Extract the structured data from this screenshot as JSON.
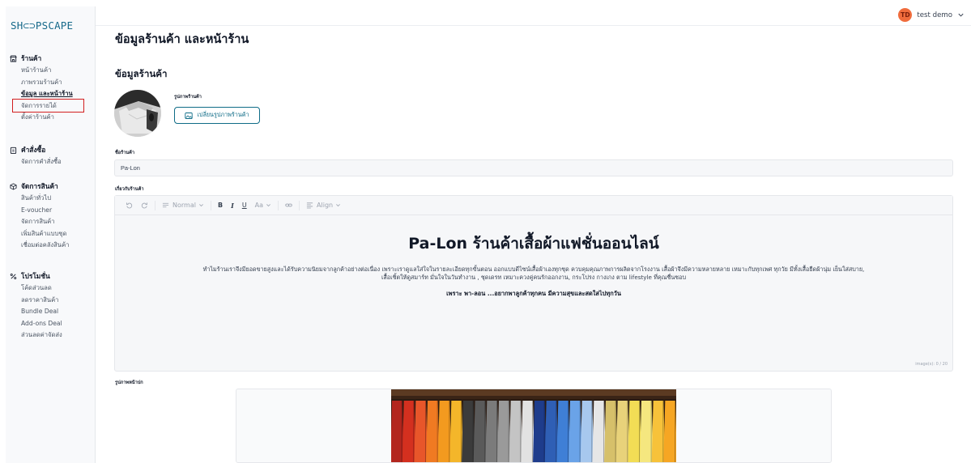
{
  "app": {
    "logo": "SH⊂⊃PSCAPE"
  },
  "header": {
    "avatar_initials": "TD",
    "user_name": "test demo"
  },
  "sidebar": {
    "sections": [
      {
        "title": "ร้านค้า",
        "icon": "store-icon",
        "items": [
          {
            "label": "หน้าร้านค้า",
            "active": false
          },
          {
            "label": "ภาพรวมร้านค้า",
            "active": false
          },
          {
            "label": "ข้อมูล และหน้าร้าน",
            "active": true
          },
          {
            "label": "จัดการรายได้",
            "active": false
          },
          {
            "label": "ตั้งค่าร้านค้า",
            "active": false
          }
        ]
      },
      {
        "title": "คำสั่งซื้อ",
        "icon": "clipboard-icon",
        "items": [
          {
            "label": "จัดการคำสั่งซื้อ",
            "active": false
          }
        ]
      },
      {
        "title": "จัดการสินค้า",
        "icon": "box-icon",
        "items": [
          {
            "label": "สินค้าทั่วไป",
            "active": false
          },
          {
            "label": "E-voucher",
            "active": false
          },
          {
            "label": "จัดการสินค้า",
            "active": false
          },
          {
            "label": "เพิ่มสินค้าแบบชุด",
            "active": false
          },
          {
            "label": "เชื่อมต่อคลังสินค้า",
            "active": false
          }
        ]
      },
      {
        "title": "โปรโมชั่น",
        "icon": "percent-icon",
        "items": [
          {
            "label": "โค้ดส่วนลด",
            "active": false
          },
          {
            "label": "ลดราคาสินค้า",
            "active": false
          },
          {
            "label": "Bundle Deal",
            "active": false
          },
          {
            "label": "Add-ons Deal",
            "active": false
          },
          {
            "label": "ส่วนลดค่าจัดส่ง",
            "active": false
          }
        ]
      }
    ]
  },
  "main": {
    "page_title": "ข้อมูลร้านค้า และหน้าร้าน",
    "section_title": "ข้อมูลร้านค้า",
    "store_image_label": "รูปภาพร้านค้า",
    "change_image_button": "เปลี่ยนรูปภาพร้านค้า",
    "store_name_label": "ชื่อร้านค้า",
    "store_name_value": "Pa-Lon",
    "about_label": "เกี่ยวกับร้านค้า",
    "toolbar": {
      "format": "Normal",
      "bold": "B",
      "italic": "I",
      "underline": "U",
      "font_size": "Aa",
      "align": "Align"
    },
    "editor": {
      "heading": "Pa-Lon ร้านค้าเสื้อผ้าแฟชั่นออนไลน์",
      "paragraph_line1": "ทำไมร้านเราจึงมียอดขายสูงและได้รับความนิยมจากลูกค้าอย่างต่อเนื่อง เพราะเราดูแลใส่ใจในรายละเอียดทุกขั้นตอน ออกแบบดีไซน์เสื้อผ้าเองทุกชุด ควบคุมคุณภาพการผลิตจากโรงงาน  เสื้อผ้าจึงมีความหลายหลาย เหมาะกับทุกเพศ ทุกวัย มีทั้งเสื้อยืดผ้านุ่ม เย็นใส่สบาย,",
      "paragraph_line2": "เสื้อเชิ้ตให้ดูสมาร์ท มั่นใจในวันทำงาน , ชุดเดรท เหมาะควงคู่คนรักออกงาน, กระโปรง กางเกง ตาม lifestyle ที่คุณชื่นชอบ",
      "tagline": "เพราะ พา-ลอน ...อยากพาลูกค้าทุกคน มีความสุขและสดใสไปทุกวัน",
      "image_count": "image(s): 0 / 20"
    },
    "cover_label": "รูปภาพหน้าปก"
  }
}
